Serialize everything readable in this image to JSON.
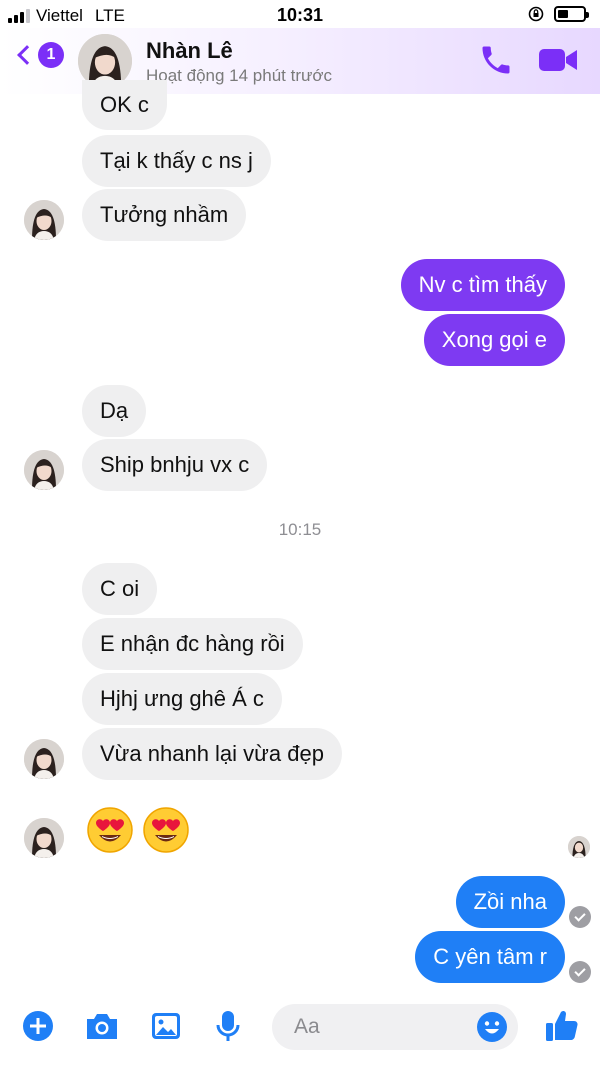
{
  "status_bar": {
    "carrier": "Viettel",
    "network": "LTE",
    "time": "10:31"
  },
  "header": {
    "back_badge": "1",
    "contact_name": "Nhàn Lê",
    "activity": "Hoạt động 14 phút trước",
    "icons": [
      "back-chevron-icon",
      "phone-icon",
      "video-camera-icon"
    ],
    "accent_color": "#7b2ff7"
  },
  "messages": [
    {
      "text": "OK c",
      "side": "in"
    },
    {
      "text": "Tại k thấy c ns j",
      "side": "in"
    },
    {
      "text": "Tưởng nhầm",
      "side": "in"
    },
    {
      "text": "Nv c tìm  thấy",
      "side": "out"
    },
    {
      "text": "Xong gọi e",
      "side": "out"
    },
    {
      "text": "Dạ",
      "side": "in"
    },
    {
      "text": "Ship bnhju vx c",
      "side": "in"
    },
    {
      "text": "C oi",
      "side": "in"
    },
    {
      "text": "E nhận đc hàng rồi",
      "side": "in"
    },
    {
      "text": "Hjhj ưng ghê Á c",
      "side": "in"
    },
    {
      "text": "Vừa nhanh lại vừa đẹp",
      "side": "in"
    },
    {
      "text": "Zồi nha",
      "side": "out"
    },
    {
      "text": "C yên tâm r",
      "side": "out"
    }
  ],
  "timestamp": "10:15",
  "emoji_reactions": [
    "heart-eyes-emoji",
    "heart-eyes-emoji"
  ],
  "composer": {
    "placeholder": "Aa",
    "icons": [
      "plus-icon",
      "camera-icon",
      "image-icon",
      "microphone-icon",
      "smiley-icon",
      "thumbs-up-icon"
    ]
  },
  "colors": {
    "incoming_bubble": "#efeff0",
    "outgoing_purple": "#7e3af2",
    "outgoing_blue": "#1f7ff6",
    "icon_blue": "#1f7ff6"
  }
}
